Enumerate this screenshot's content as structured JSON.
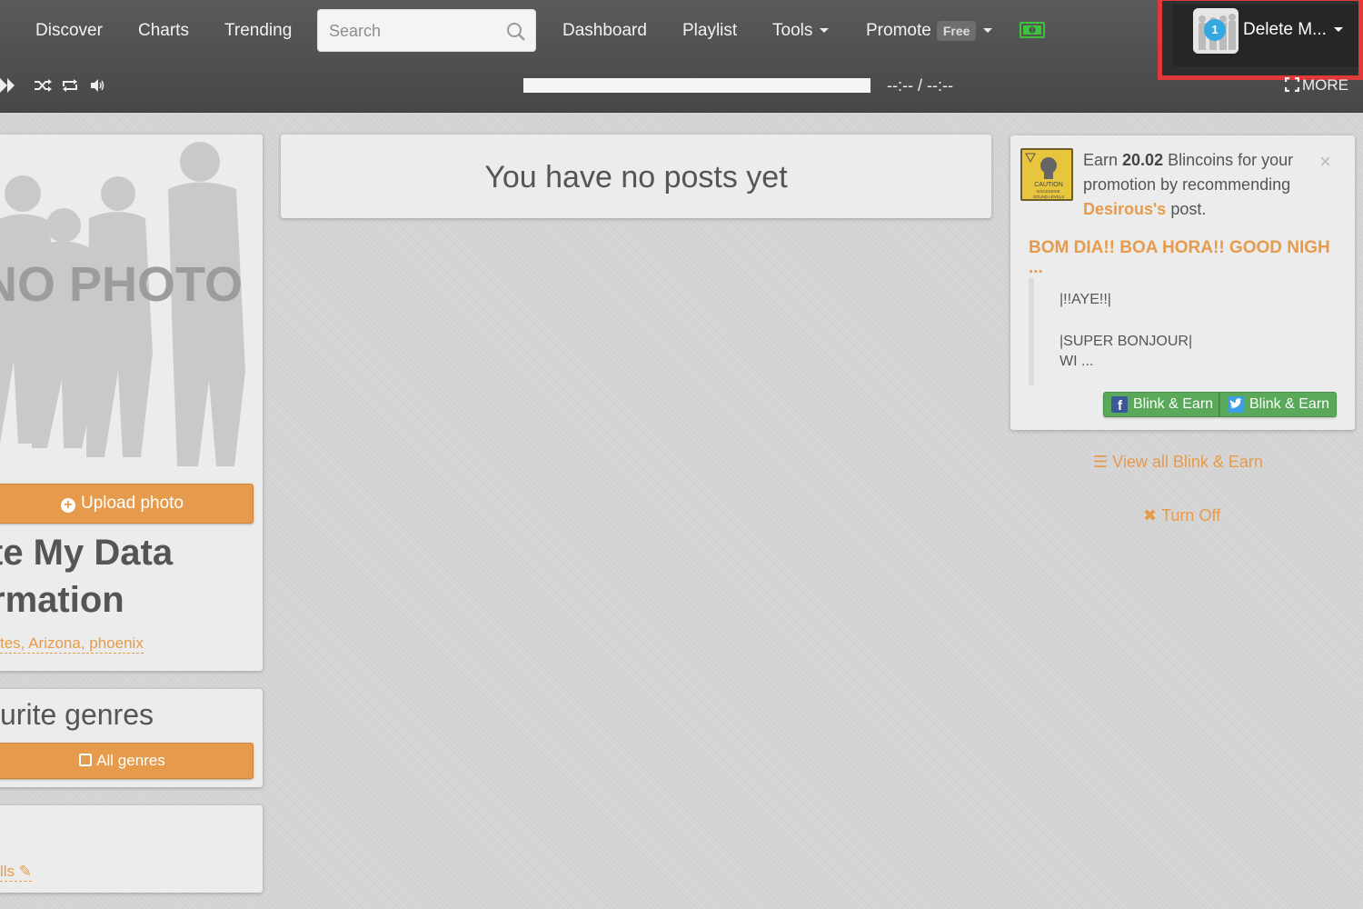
{
  "nav": {
    "discover": "Discover",
    "charts": "Charts",
    "trending": "Trending",
    "search_placeholder": "Search",
    "dashboard": "Dashboard",
    "playlist": "Playlist",
    "tools": "Tools",
    "promote": "Promote",
    "free_badge": "Free",
    "user_name": "Delete M...",
    "avatar_badge": "1"
  },
  "player": {
    "time": "--:-- / --:--",
    "more": "MORE"
  },
  "profile": {
    "no_photo_text": "NO PHOTO",
    "upload_photo": "Upload photo",
    "name_line1": "te My Data",
    "name_line2": "rmation",
    "location": "tes, Arizona, phoenix",
    "genres_title": "urite genres",
    "all_genres": "All genres",
    "details_link": "lls"
  },
  "posts": {
    "empty_message": "You have no posts yet"
  },
  "promo": {
    "earn_prefix": "Earn ",
    "amount": "20.02",
    "earn_mid": " Blincoins for your promotion by recommending ",
    "user": "Desirous's",
    "earn_suffix": " post.",
    "post_title": "BOM DIA!! BOA HORA!! GOOD NIGH ...",
    "quote_line1": "|!!AYE!!|",
    "quote_line2": "|SUPER BONJOUR|",
    "quote_line3": "WI ...",
    "fb_button": "Blink & Earn",
    "tw_button": "Blink & Earn",
    "view_all": "View all Blink & Earn",
    "turn_off": "Turn Off",
    "image_caption": "CAUTION EXCESSIVE SOUND LEVELS"
  },
  "colors": {
    "accent": "#e69b4c",
    "header": "#4f4f4f",
    "highlight_border": "#e0393a",
    "earn_button": "#5aa85a"
  }
}
